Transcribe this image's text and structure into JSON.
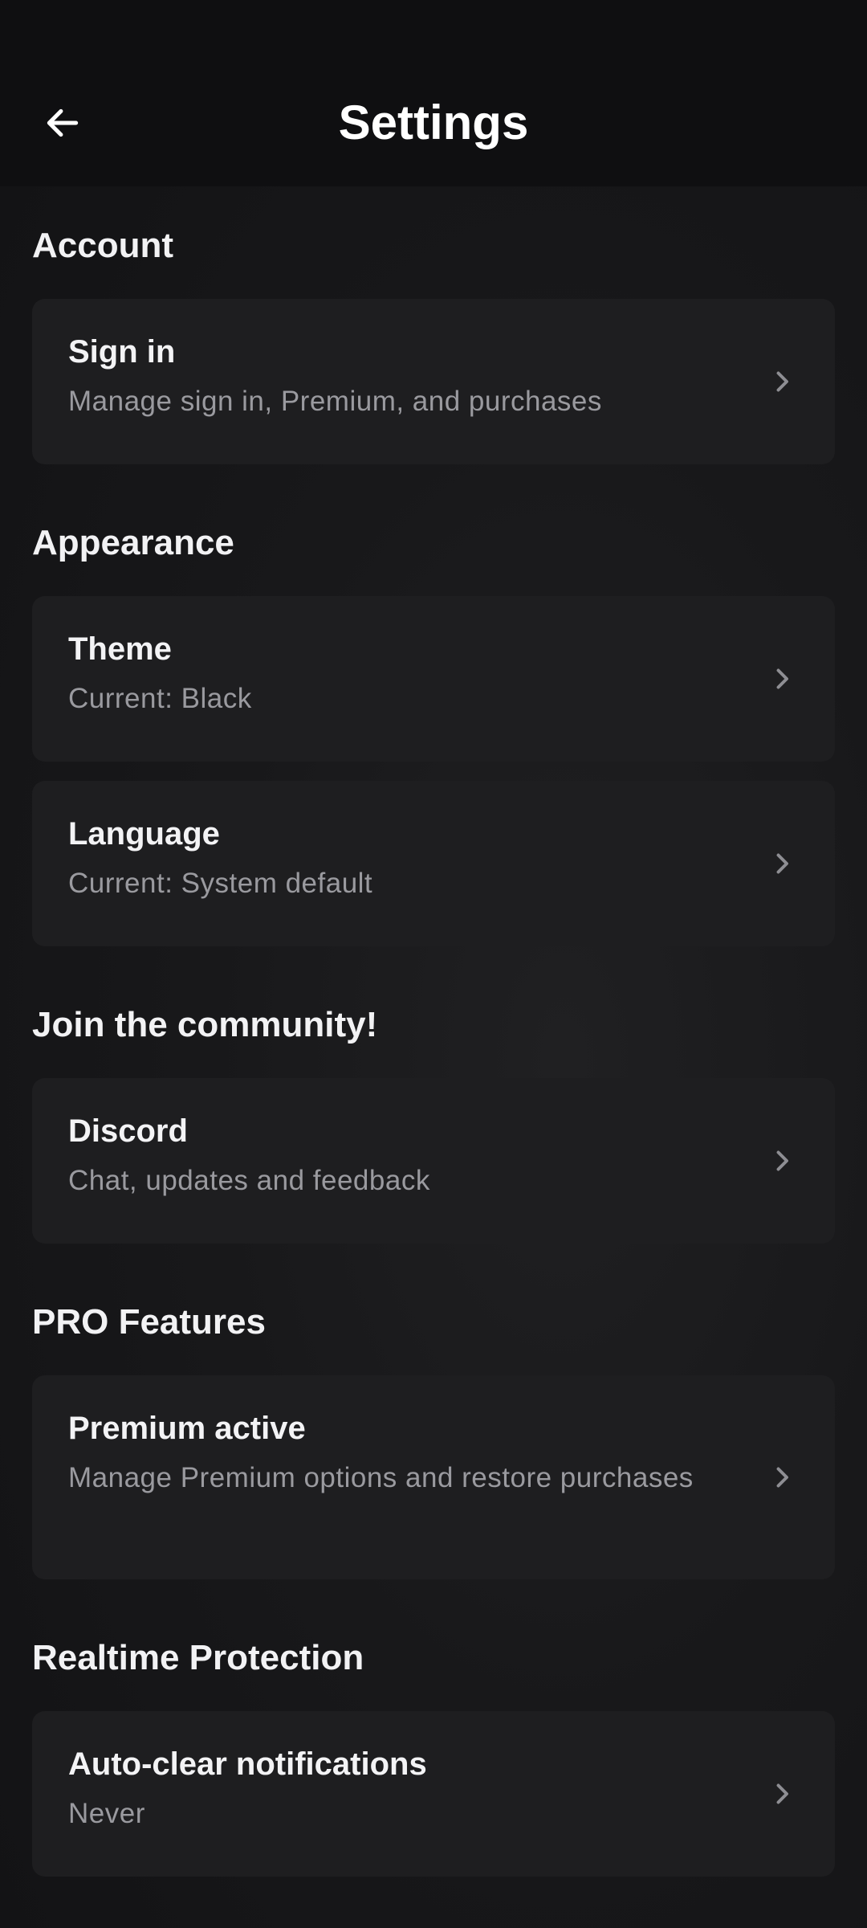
{
  "header": {
    "title": "Settings",
    "back_icon": "arrow-left-icon"
  },
  "sections": [
    {
      "title": "Account",
      "items": [
        {
          "title": "Sign in",
          "subtitle": "Manage sign in, Premium, and purchases"
        }
      ]
    },
    {
      "title": "Appearance",
      "items": [
        {
          "title": "Theme",
          "subtitle": "Current: Black"
        },
        {
          "title": "Language",
          "subtitle": "Current: System default"
        }
      ]
    },
    {
      "title": "Join the community!",
      "items": [
        {
          "title": "Discord",
          "subtitle": "Chat, updates and feedback"
        }
      ]
    },
    {
      "title": "PRO Features",
      "items": [
        {
          "title": "Premium active",
          "subtitle": "Manage Premium options and restore purchases"
        }
      ]
    },
    {
      "title": "Realtime Protection",
      "items": [
        {
          "title": "Auto-clear notifications",
          "subtitle": "Never"
        }
      ]
    }
  ],
  "colors": {
    "background": "#141416",
    "topbar": "#0f0f11",
    "card": "#1e1e20",
    "title_text": "#f3f3f5",
    "subtitle_text": "#9a9a9f",
    "chevron": "#8e8e93"
  },
  "icons": {
    "chevron": "chevron-right-icon"
  }
}
